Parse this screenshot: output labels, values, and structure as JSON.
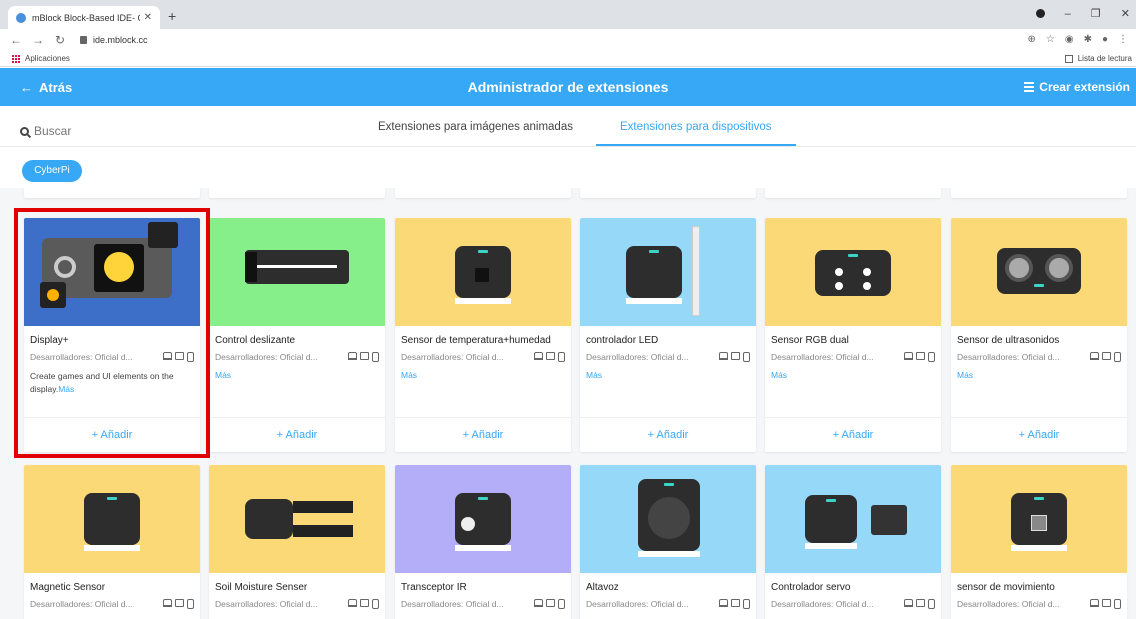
{
  "browser": {
    "tab_title": "mBlock Block-Based IDE- Coding",
    "url": "ide.mblock.cc",
    "bookmarks_apps": "Aplicaciones",
    "reading_list": "Lista de lectura"
  },
  "header": {
    "back_label": "Atrás",
    "title": "Administrador de extensiones",
    "create_label": "Crear extensión",
    "accent": "#37a8f5"
  },
  "search": {
    "placeholder": "Buscar"
  },
  "tabs": [
    {
      "label": "Extensiones para imágenes animadas"
    },
    {
      "label": "Extensiones para dispositivos"
    }
  ],
  "filter": {
    "chip": "CyberPi"
  },
  "common": {
    "developers": "Desarrolladores:  Oficial d...",
    "more": "Más",
    "add": "+  Añadir"
  },
  "cards_row1": [
    {
      "name": "Display+",
      "description": "Create games and UI elements on the display.",
      "bg": "#3d6fc9"
    },
    {
      "name": "Control deslizante",
      "bg": "#86ef8a"
    },
    {
      "name": "Sensor de temperatura+humedad",
      "bg": "#fbd977"
    },
    {
      "name": "controlador LED",
      "bg": "#95d8f7"
    },
    {
      "name": "Sensor RGB dual",
      "bg": "#fbd977"
    },
    {
      "name": "Sensor de ultrasonidos",
      "bg": "#fbd977"
    }
  ],
  "cards_row2": [
    {
      "name": "Magnetic Sensor",
      "bg": "#fbd977"
    },
    {
      "name": "Soil Moisture Senser",
      "bg": "#fbd977"
    },
    {
      "name": "Transceptor IR",
      "bg": "#b3aef7"
    },
    {
      "name": "Altavoz",
      "bg": "#95d8f7"
    },
    {
      "name": "Controlador servo",
      "bg": "#95d8f7"
    },
    {
      "name": "sensor de movimiento",
      "bg": "#fbd977"
    }
  ],
  "highlight_color": "#e00000"
}
